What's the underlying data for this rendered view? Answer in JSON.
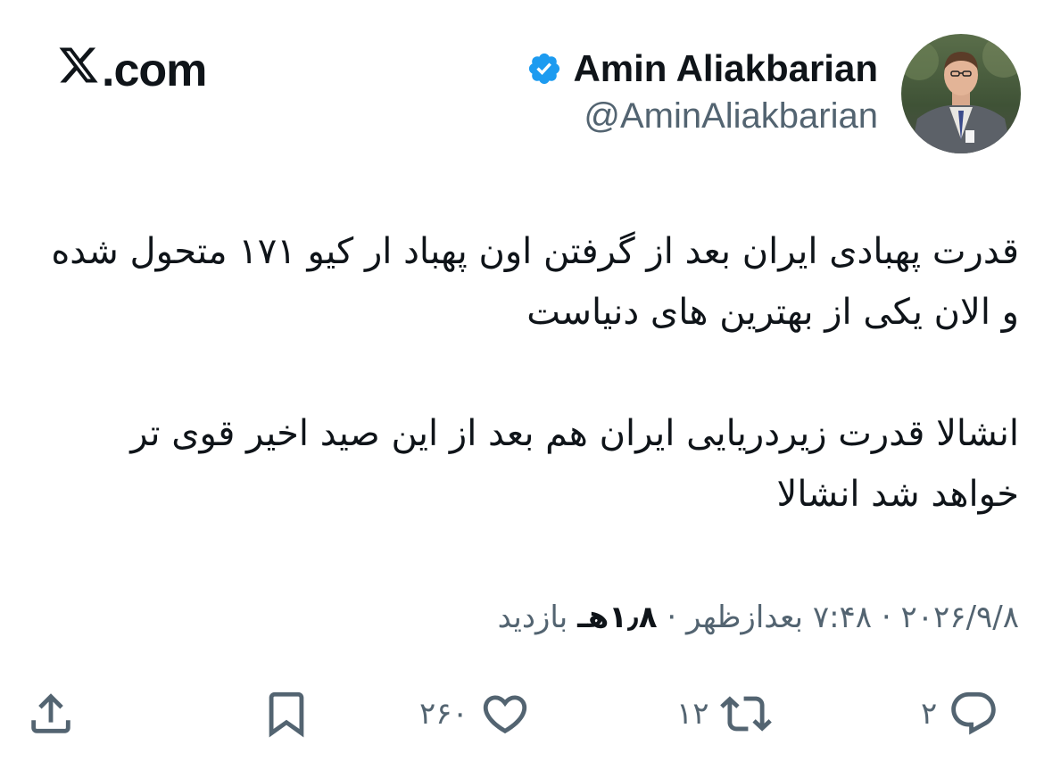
{
  "site": {
    "logo_text": ".com"
  },
  "author": {
    "display_name": "Amin Aliakbarian",
    "handle": "@AminAliakbarian",
    "verified": true
  },
  "tweet": {
    "paragraphs": [
      "قدرت پهبادی ایران بعد از گرفتن اون پهباد ار کیو ۱۷۱ متحول شده و الان یکی از بهترین های دنیاست",
      "انشالا قدرت زیردریایی ایران هم بعد از این صید اخیر قوی تر خواهد شد انشالا"
    ]
  },
  "meta": {
    "date": "۲۰۲۶/۹/۸",
    "separator": "·",
    "time": "۷:۴۸ بعدازظهر",
    "views_count": "۱٫۸هـ",
    "views_label": "بازدید"
  },
  "actions": {
    "reply_count": "۲",
    "retweet_count": "۱۲",
    "like_count": "۲۶۰"
  },
  "colors": {
    "text": "#0f1419",
    "secondary": "#536471",
    "verified": "#1d9bf0"
  },
  "icons": [
    "x-logo-icon",
    "verified-badge-icon",
    "reply-icon",
    "retweet-icon",
    "like-icon",
    "bookmark-icon",
    "share-icon"
  ]
}
